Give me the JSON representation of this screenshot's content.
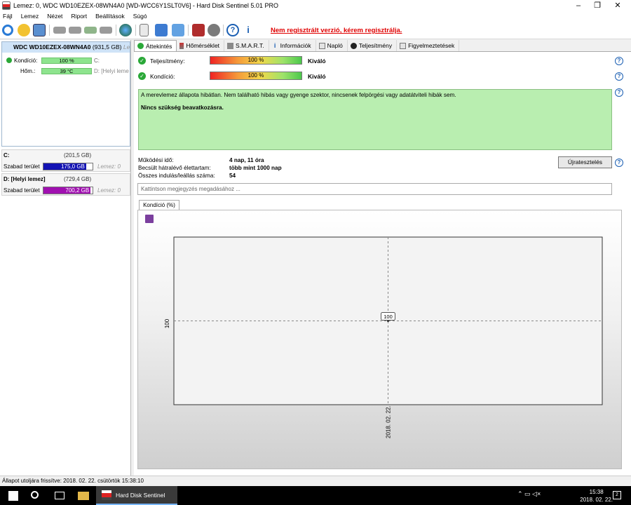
{
  "window": {
    "title": "Lemez: 0, WDC WD10EZEX-08WN4A0 [WD-WCC6Y1SLT0V6]  -  Hard Disk Sentinel 5.01 PRO",
    "minimize": "–",
    "restore": "❐",
    "close": "✕"
  },
  "menu": [
    "Fájl",
    "Lemez",
    "Nézet",
    "Riport",
    "Beállítások",
    "Súgó"
  ],
  "toolbar": {
    "icons": [
      "refresh-icon",
      "warning-icon",
      "window-icon",
      "disk-icon",
      "disk-check-icon",
      "disk-ok-icon",
      "disk-tool-icon",
      "globe-icon",
      "report-icon",
      "copy-icon",
      "send-icon",
      "erase-icon",
      "settings-icon",
      "help-icon",
      "info-icon"
    ],
    "register_link": "Nem regisztrált verzió, kérem regisztrálja."
  },
  "left": {
    "disk": {
      "name": "WDC WD10EZEX-08WN4A0",
      "size": "(931,5 GB)",
      "disk_label": "Lem",
      "health_label": "Kondíció:",
      "health_value": "100 %",
      "health_drive": "C:",
      "temp_label": "Hőm.:",
      "temp_value": "39 °C",
      "temp_drive": "D: [Helyi leme"
    },
    "volumes": [
      {
        "name": "C:",
        "size": "(201,5 GB)",
        "free_label": "Szabad terület",
        "free_value": "175,0 GB",
        "free_fraction": 0.87,
        "disk": "Lemez: 0",
        "color": "#1313b4"
      },
      {
        "name": "D: [Helyi lemez]",
        "size": "(729,4 GB)",
        "free_label": "Szabad terület",
        "free_value": "700,2 GB",
        "free_fraction": 0.96,
        "disk": "Lemez: 0",
        "color": "#a010b0"
      }
    ]
  },
  "tabs": [
    "Áttekintés",
    "Hőmérséklet",
    "S.M.A.R.T.",
    "Információk",
    "Napló",
    "Teljesítmény",
    "Figyelmeztetések"
  ],
  "overview": {
    "perf_label": "Teljesítmény:",
    "perf_value": "100 %",
    "perf_rating": "Kiváló",
    "health_label": "Kondíció:",
    "health_value": "100 %",
    "health_rating": "Kiváló",
    "status_text": "A merevlemez állapota hibátlan. Nem található hibás vagy gyenge szektor, nincsenek felpörgési vagy adatátviteli hibák sem.",
    "status_advice": "Nincs szükség beavatkozásra.",
    "uptime_label": "Működési idő:",
    "uptime_value": "4 nap, 11 óra",
    "life_label": "Becsült hátralévő élettartam:",
    "life_value": "több mint 1000 nap",
    "starts_label": "Összes indulás/leállás száma:",
    "starts_value": "54",
    "retest_button": "Újratesztelés",
    "note_placeholder": "Kattintson megjegyzés megadásához ...",
    "chart_tab": "Kondíció  (%)",
    "help": "?"
  },
  "chart_data": {
    "type": "line",
    "x": [
      "2018. 02. 22."
    ],
    "series": [
      {
        "values": [
          100
        ]
      }
    ],
    "data_labels": [
      "100"
    ],
    "y_ticks": [
      "100"
    ],
    "grid": true
  },
  "statusbar": "Állapot utoljára frissítve: 2018. 02. 22. csütörtök 15:38:10",
  "taskbar": {
    "app": "Hard Disk Sentinel",
    "time": "15:38",
    "date": "2018. 02. 22.",
    "tray": "⌃  ▭  ◁×",
    "notifications": "2"
  }
}
